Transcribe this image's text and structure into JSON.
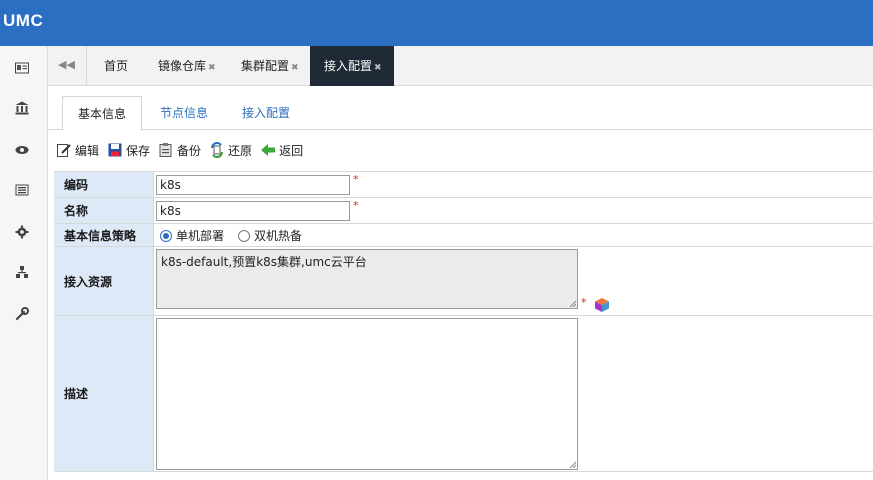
{
  "app": {
    "logo": "UMC"
  },
  "sidebar": {
    "icons": [
      "id-card-icon",
      "bank-icon",
      "eye-icon",
      "list-icon",
      "gear-icon",
      "sitemap-icon",
      "wrench-icon"
    ]
  },
  "tabs": [
    {
      "label": "首页",
      "closable": false
    },
    {
      "label": "镜像仓库",
      "closable": true
    },
    {
      "label": "集群配置",
      "closable": true
    },
    {
      "label": "接入配置",
      "closable": true,
      "active": true
    }
  ],
  "subtabs": [
    {
      "label": "基本信息",
      "active": true
    },
    {
      "label": "节点信息"
    },
    {
      "label": "接入配置"
    }
  ],
  "toolbar": {
    "edit": "编辑",
    "save": "保存",
    "backup": "备份",
    "restore": "还原",
    "back": "返回"
  },
  "form": {
    "code": {
      "label": "编码",
      "value": "k8s",
      "required_mark": "*"
    },
    "name": {
      "label": "名称",
      "value": "k8s",
      "required_mark": "*"
    },
    "strategy": {
      "label": "基本信息策略",
      "options": [
        "单机部署",
        "双机热备"
      ],
      "selected": "单机部署"
    },
    "source": {
      "label": "接入资源",
      "value": "k8s-default,预置k8s集群,umc云平台",
      "required_mark": "*"
    },
    "desc": {
      "label": "描述",
      "value": ""
    }
  },
  "colors": {
    "header": "#2a6fc1",
    "label_bg": "#dde9f7",
    "active_tab": "#1f2a36"
  }
}
